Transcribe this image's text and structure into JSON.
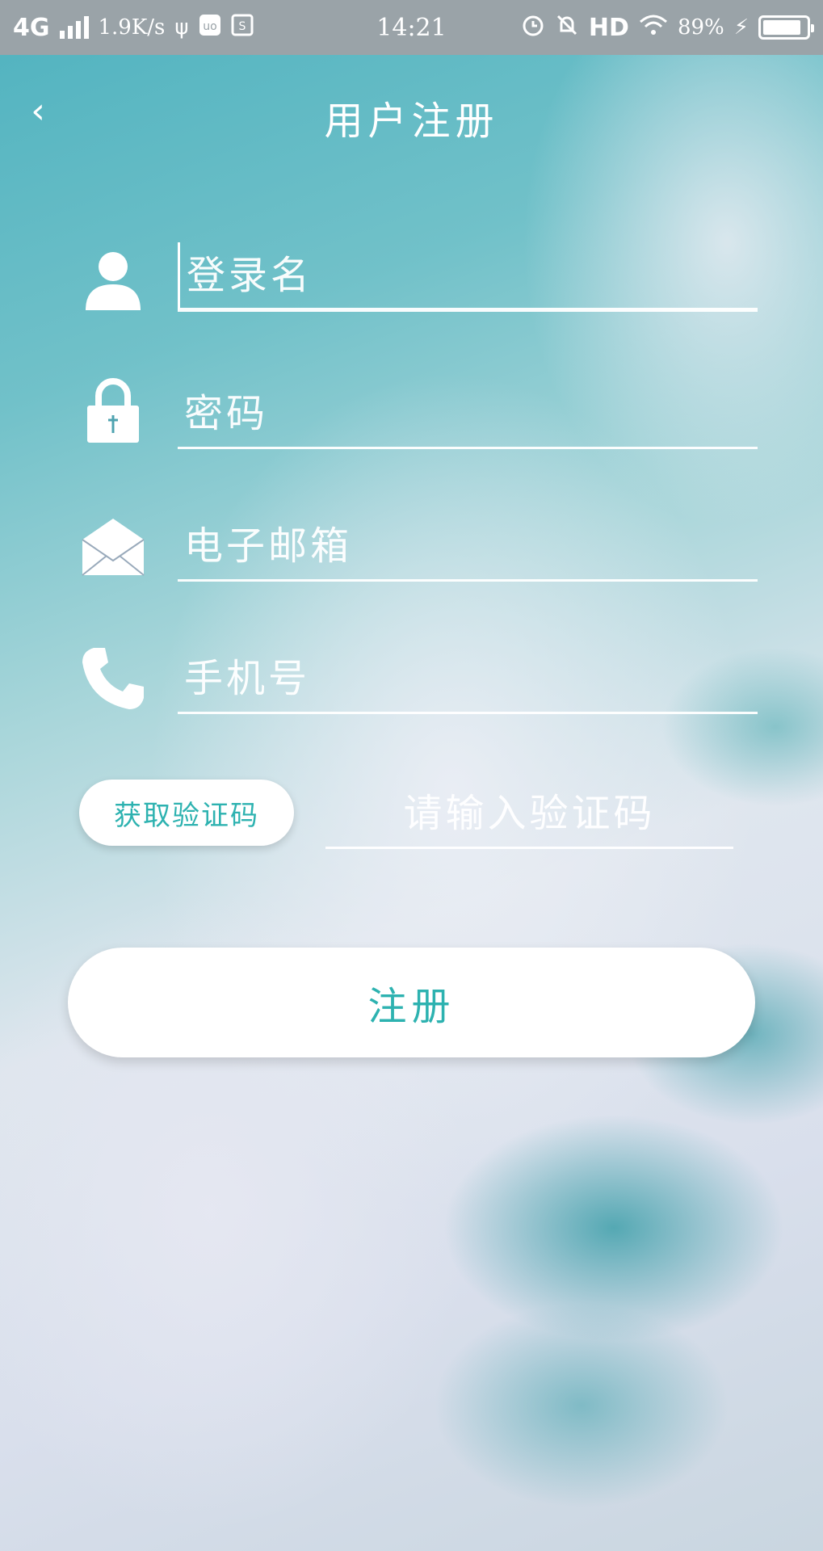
{
  "status_bar": {
    "network": "4G",
    "speed": "1.9K/s",
    "time": "14:21",
    "hd": "HD",
    "battery": "89%",
    "battery_level": 0.89,
    "icons": [
      "usb-icon",
      "app-icon",
      "screenshot-icon",
      "alarm-icon",
      "mute-icon",
      "wifi-icon",
      "charging-icon"
    ]
  },
  "header": {
    "back_icon": "chevron-left-icon",
    "title": "用户注册"
  },
  "form": {
    "username": {
      "placeholder": "登录名",
      "value": "",
      "icon": "user-icon"
    },
    "password": {
      "placeholder": "密码",
      "value": "",
      "icon": "lock-icon"
    },
    "email": {
      "placeholder": "电子邮箱",
      "value": "",
      "icon": "envelope-icon"
    },
    "phone": {
      "placeholder": "手机号",
      "value": "",
      "icon": "phone-icon"
    },
    "code_button": "获取验证码",
    "code_input": {
      "placeholder": "请输入验证码",
      "value": ""
    }
  },
  "register_button": "注册",
  "colors": {
    "accent": "#2db2b0",
    "status_bar": "#9aa3a8"
  }
}
